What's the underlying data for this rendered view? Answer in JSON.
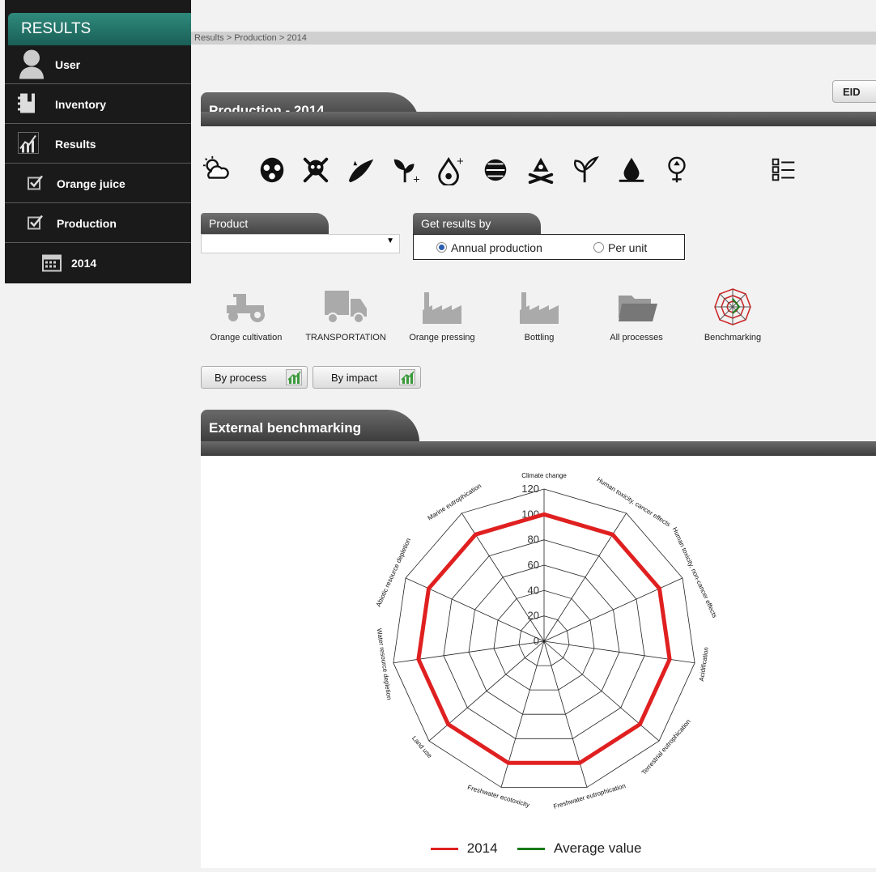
{
  "sidebar": {
    "header": "RESULTS",
    "items": [
      {
        "label": "User",
        "icon": "user-icon"
      },
      {
        "label": "Inventory",
        "icon": "inventory-icon"
      },
      {
        "label": "Results",
        "icon": "results-chart-icon"
      },
      {
        "label": "Orange juice",
        "icon": "checkbox-icon"
      },
      {
        "label": "Production",
        "icon": "checkbox-icon"
      },
      {
        "label": "2014",
        "icon": "calendar-icon"
      }
    ]
  },
  "breadcrumb": "Results > Production > 2014",
  "header": {
    "eid_label": "EID"
  },
  "production": {
    "title": "Production - 2014"
  },
  "impact_icons": [
    "climate-change-icon",
    "ozone-mask-icon",
    "toxicity-skull-icon",
    "acidification-icon",
    "eutrophication-plant-icon",
    "water-drop-icon",
    "particulate-icon",
    "ecotoxicity-skull-icon",
    "land-use-plant-icon",
    "water-resource-icon",
    "resource-depletion-icon",
    "checklist-icon"
  ],
  "product": {
    "label": "Product",
    "value": ""
  },
  "results_by": {
    "label": "Get results by",
    "options": [
      "Annual production",
      "Per unit"
    ],
    "selected": "Annual production"
  },
  "processes": [
    "Orange cultivation",
    "TRANSPORTATION",
    "Orange pressing",
    "Bottling",
    "All processes",
    "Benchmarking"
  ],
  "view_buttons": [
    "By process",
    "By impact"
  ],
  "benchmark": {
    "title": "External benchmarking"
  },
  "colors": {
    "series_2014": "#e02020",
    "series_average": "#1a7a1a",
    "teal": "#2f8a7c"
  },
  "chart_data": {
    "type": "radar",
    "categories": [
      "Climate change",
      "Human toxicity, cancer effects",
      "Human toxicity, non-cancer effects",
      "Acidification",
      "Terrestrial eutrophication",
      "Freshwater eutrophication",
      "Freshwater ecotoxicity",
      "Land use",
      "Water resource depletion",
      "Abiotic resource depletion",
      "Marine eutrophication"
    ],
    "ticks": [
      0,
      20,
      40,
      60,
      80,
      100,
      120
    ],
    "rlim": [
      0,
      120
    ],
    "series": [
      {
        "name": "2014",
        "values": [
          100,
          100,
          100,
          100,
          100,
          100,
          100,
          100,
          100,
          100,
          100
        ]
      },
      {
        "name": "Average value",
        "values": []
      }
    ],
    "legend": "bottom"
  }
}
